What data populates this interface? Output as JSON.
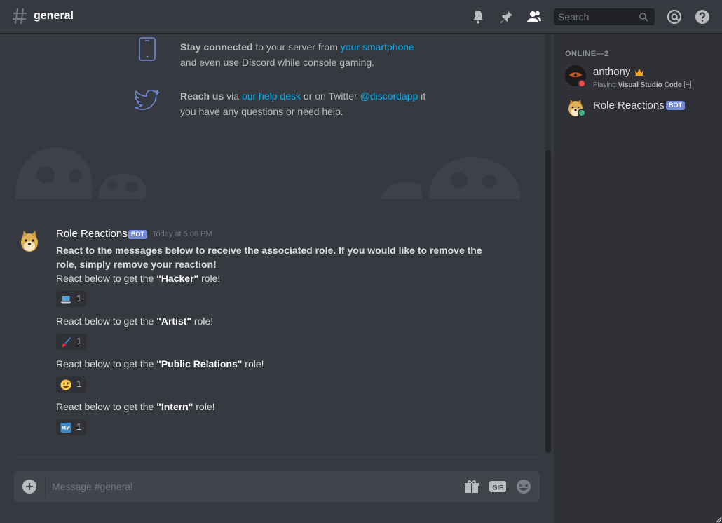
{
  "header": {
    "channel": "general",
    "search_placeholder": "Search"
  },
  "welcome": {
    "mobile": {
      "bold": "Stay connected",
      "text1": " to your server from ",
      "link": "your smartphone",
      "text2": " and even use Discord while console gaming."
    },
    "twitter": {
      "bold": "Reach us",
      "text1": " via ",
      "link1": "our help desk",
      "text2": " or on Twitter ",
      "link2": "@discordapp",
      "text3": " if you have any questions or need help."
    }
  },
  "message": {
    "author": "Role Reactions",
    "badge": "BOT",
    "timestamp": "Today at 5:06 PM",
    "intro": "React to the messages below to receive the associated role. If you would like to remove the role, simply remove your reaction!",
    "prefix": "React below to get the ",
    "suffix": " role!",
    "roles": [
      {
        "name": "\"Hacker\"",
        "emoji": "laptop-emoji",
        "count": "1"
      },
      {
        "name": "\"Artist\"",
        "emoji": "paintbrush-emoji",
        "count": "1"
      },
      {
        "name": "\"Public Relations\"",
        "emoji": "smiley-emoji",
        "count": "1"
      },
      {
        "name": "\"Intern\"",
        "emoji": "new-emoji",
        "count": "1"
      }
    ]
  },
  "composer": {
    "placeholder": "Message #general"
  },
  "members": {
    "heading": "ONLINE—2",
    "list": [
      {
        "name": "anthony",
        "activity_prefix": "Playing ",
        "activity": "Visual Studio Code",
        "status": "dnd",
        "status_color": "#f04747"
      },
      {
        "name": "Role Reactions",
        "badge": "BOT",
        "status": "online",
        "status_color": "#43b581"
      }
    ]
  },
  "colors": {
    "link": "#00b0f4",
    "blurple": "#7289da",
    "background": "#36393f",
    "sidebar": "#2f3136"
  }
}
